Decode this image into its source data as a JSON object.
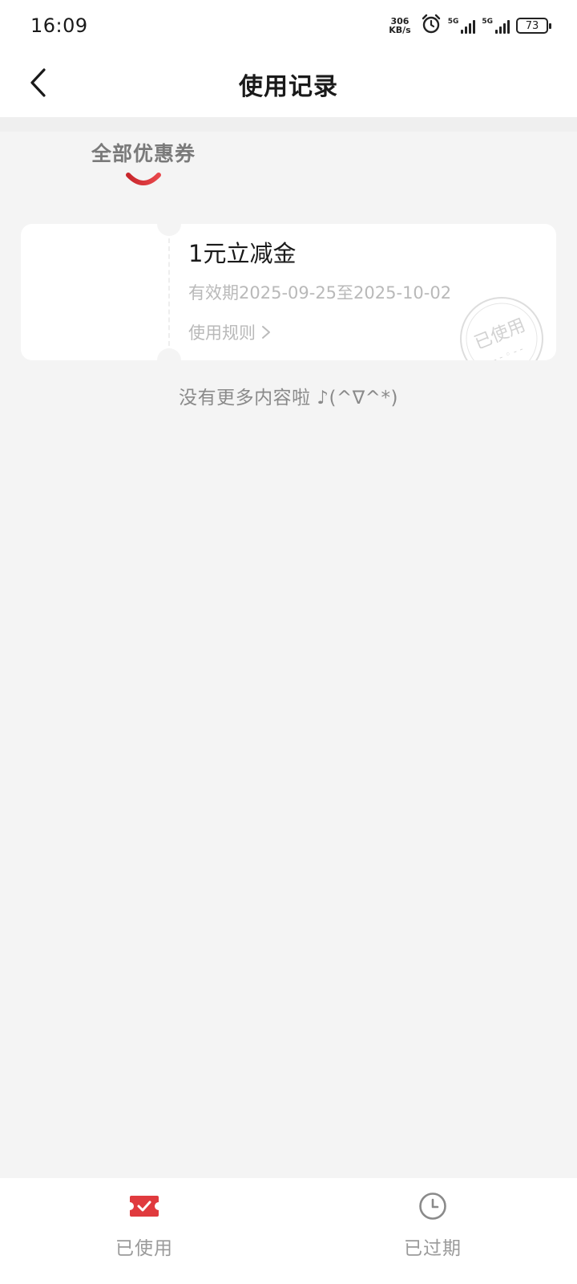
{
  "status_bar": {
    "time": "16:09",
    "speed_value": "306",
    "speed_unit": "KB/s",
    "sig1_label": "5G",
    "sig2_label": "5G",
    "battery": "73"
  },
  "nav": {
    "title": "使用记录"
  },
  "tabs": {
    "all_label": "全部优惠券",
    "accent_color": "#e03a3e"
  },
  "coupon": {
    "title": "1元立减金",
    "validity": "有效期2025-09-25至2025-10-02",
    "rules_label": "使用规则",
    "stamp_text": "已使用"
  },
  "list_end_text": "没有更多内容啦 ♪(^∇^*)",
  "bottom_tabs": {
    "used_label": "已使用",
    "expired_label": "已过期"
  }
}
